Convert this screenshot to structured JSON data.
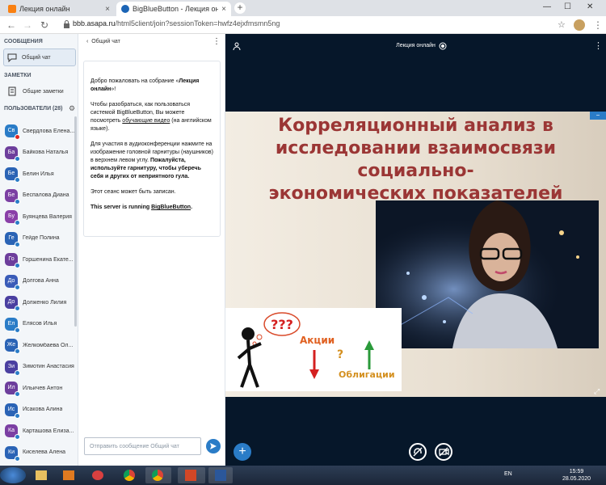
{
  "browser": {
    "tabs": [
      {
        "title": "Лекция онлайн"
      },
      {
        "title": "BigBlueButton - Лекция онлайн"
      }
    ],
    "url_host": "bbb.asapa.ru",
    "url_path": "/html5client/join?sessionToken=hwfz4ejxfmsmn5ng"
  },
  "sidebar": {
    "messages_title": "СООБЩЕНИЯ",
    "public_chat_label": "Общий чат",
    "notes_title": "ЗАМЕТКИ",
    "shared_notes_label": "Общие заметки",
    "users_title": "ПОЛЬЗОВАТЕЛИ (28)",
    "users": [
      {
        "initials": "Св",
        "name": "Свердлова Елена...",
        "color": "#2a7cc7",
        "mic": "red"
      },
      {
        "initials": "Ба",
        "name": "Байкова Наталья",
        "color": "#6d3e9c",
        "mic": "blue"
      },
      {
        "initials": "Бе",
        "name": "Белин Илья",
        "color": "#2a63b5",
        "mic": "blue"
      },
      {
        "initials": "Бе",
        "name": "Беспалова Диана",
        "color": "#7b3fa3",
        "mic": "blue"
      },
      {
        "initials": "Бу",
        "name": "Буянцева Валерия",
        "color": "#8a3fa8",
        "mic": "blue"
      },
      {
        "initials": "Ге",
        "name": "Гейде Полина",
        "color": "#2a63b5",
        "mic": "blue"
      },
      {
        "initials": "Го",
        "name": "Горшенина Екате...",
        "color": "#6d3e9c",
        "mic": "blue"
      },
      {
        "initials": "До",
        "name": "Долгова Анна",
        "color": "#3a5cb8",
        "mic": "blue"
      },
      {
        "initials": "До",
        "name": "Долженко Лилия",
        "color": "#4a3fa0",
        "mic": "blue"
      },
      {
        "initials": "Ел",
        "name": "Елясов Илья",
        "color": "#2a7cc7",
        "mic": "blue"
      },
      {
        "initials": "Же",
        "name": "Желкомбаева Ол...",
        "color": "#2a63b5",
        "mic": "blue"
      },
      {
        "initials": "Зи",
        "name": "Зимотин Анастасия",
        "color": "#4a3fa0",
        "mic": "blue"
      },
      {
        "initials": "Ил",
        "name": "Ильичев Антон",
        "color": "#6d3e9c",
        "mic": "blue"
      },
      {
        "initials": "Ис",
        "name": "Исакова Алина",
        "color": "#2a63b5",
        "mic": "blue"
      },
      {
        "initials": "Ка",
        "name": "Карташова Елиза...",
        "color": "#7b3fa3",
        "mic": "blue"
      },
      {
        "initials": "Ки",
        "name": "Киселева Алена",
        "color": "#2a63b5",
        "mic": "blue"
      }
    ]
  },
  "chat": {
    "header": "Общий чат",
    "welcome_1_pre": "Добро пожаловать на собрание «",
    "welcome_1_bold": "Лекция онлайн",
    "welcome_1_post": "»!",
    "welcome_2_pre": "Чтобы разобраться, как пользоваться системой BigBlueButton, Вы можете посмотреть ",
    "welcome_2_link": "обучающие видео",
    "welcome_2_post": " (на английском языке).",
    "welcome_3_pre": "Для участия в аудиоконференции нажмите на изображение головной гарнитуры (наушников) в верхнем левом углу. ",
    "welcome_3_bold": "Пожалуйста, используйте гарнитуру, чтобы уберечь себя и других от неприятного гула.",
    "welcome_4": "Этот сеанс может быть записан.",
    "welcome_5_pre": "This server is running ",
    "welcome_5_link": "BigBlueButton",
    "welcome_5_post": ".",
    "input_placeholder": "Отправить сообщение Общий чат"
  },
  "presentation": {
    "meeting_title": "Лекция онлайн",
    "slide_title_lines": [
      "Корреляционный анализ в",
      "исследовании взаимосвязи социально-",
      "экономических показателей"
    ],
    "cartoon_qmarks": "???",
    "cartoon_stocks": "Акции",
    "cartoon_question": "?",
    "cartoon_bonds": "Облигации"
  },
  "taskbar": {
    "lang": "EN",
    "time": "15:59",
    "date": "28.05.2020"
  }
}
